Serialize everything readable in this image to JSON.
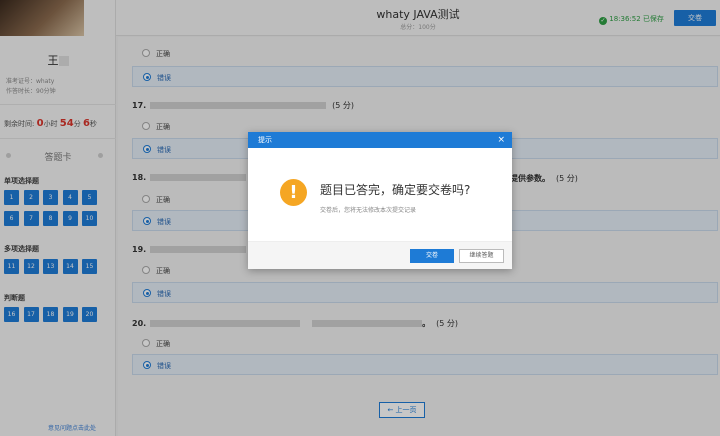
{
  "sidebar": {
    "name": "王",
    "exam_id_label": "准考证号：",
    "exam_id_value": "whaty",
    "duration_label": "作答时长：",
    "duration_value": "90分钟",
    "timer_label": "剩余时间:",
    "timer_h": "0",
    "timer_h_unit": "小时",
    "timer_m": "54",
    "timer_m_unit": "分",
    "timer_s": "6",
    "timer_s_unit": "秒",
    "card_title": "答题卡",
    "group_single": "单项选择题",
    "group_multi": "多项选择题",
    "group_judge": "判断题",
    "nums": [
      "1",
      "2",
      "3",
      "4",
      "5",
      "6",
      "7",
      "8",
      "9",
      "10",
      "11",
      "12",
      "13",
      "14",
      "15",
      "16",
      "17",
      "18",
      "19",
      "20"
    ],
    "feedback": "意见问题点击此处"
  },
  "header": {
    "title": "whaty JAVA测试",
    "score": "总分：100分",
    "time": "18:36:52",
    "saved": "已保存",
    "submit": "交卷"
  },
  "questions": {
    "opt_true": "正确",
    "opt_false": "错误",
    "q17": "17.",
    "q18": "18.",
    "q18_tail": "提供参数。",
    "q19": "19.",
    "q20": "20.",
    "q20_tail": "。",
    "score_tag": "(5 分)",
    "prev": "← 上一页"
  },
  "dialog": {
    "title": "提示",
    "close": "×",
    "message": "题目已答完，确定要交卷吗?",
    "sub": "交卷后，您将无法修改本次提交记录",
    "ok": "交卷",
    "cancel": "继续答题"
  }
}
